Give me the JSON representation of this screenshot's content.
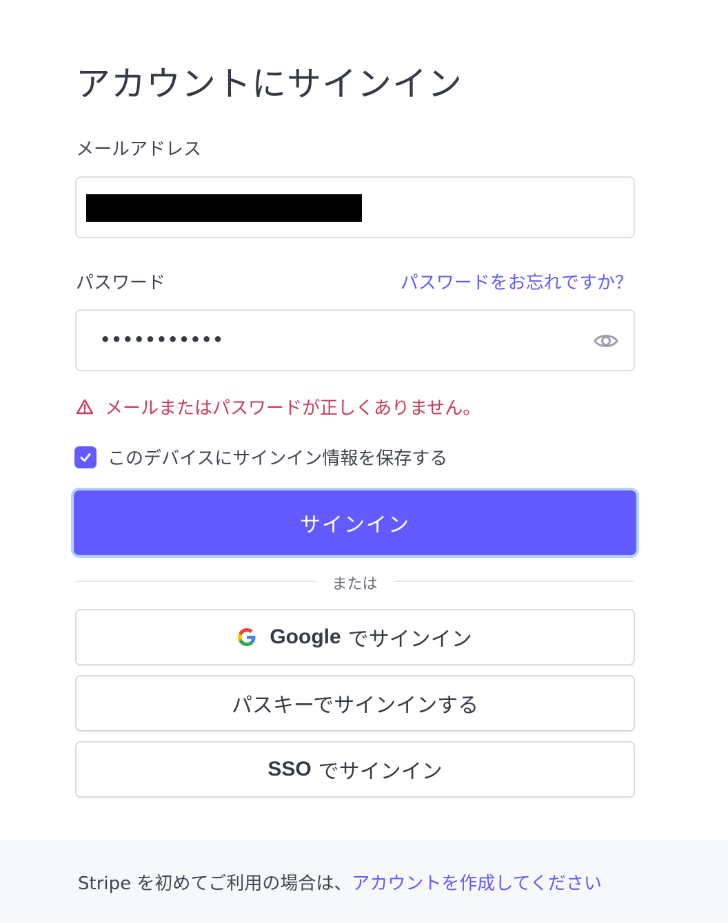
{
  "page": {
    "title": "アカウントにサインイン"
  },
  "email": {
    "label": "メールアドレス",
    "value": "████████████████████"
  },
  "password": {
    "label": "パスワード",
    "forgot_link": "パスワードをお忘れですか？",
    "value": "•••••••••••",
    "toggle_icon": "eye-icon"
  },
  "error": {
    "icon": "warning-icon",
    "message": "メールまたはパスワードが正しくありません。"
  },
  "remember": {
    "label": "このデバイスにサインイン情報を保存する",
    "checked": true
  },
  "signin_button": {
    "label": "サインイン"
  },
  "divider": {
    "text": "または"
  },
  "alt_signin": {
    "google_brand": "Google",
    "google_suffix": "でサインイン",
    "passkey_label": "パスキーでサインインする",
    "sso_brand": "SSO",
    "sso_suffix": "でサインイン"
  },
  "footer": {
    "prefix": "Stripe を初めてご利用の場合は、",
    "create_link": "アカウントを作成してください"
  },
  "colors": {
    "accent": "#635bff",
    "error": "#c83c5b",
    "focus_ring": "#b3d3f5",
    "footer_bg": "#f6f8fa"
  }
}
